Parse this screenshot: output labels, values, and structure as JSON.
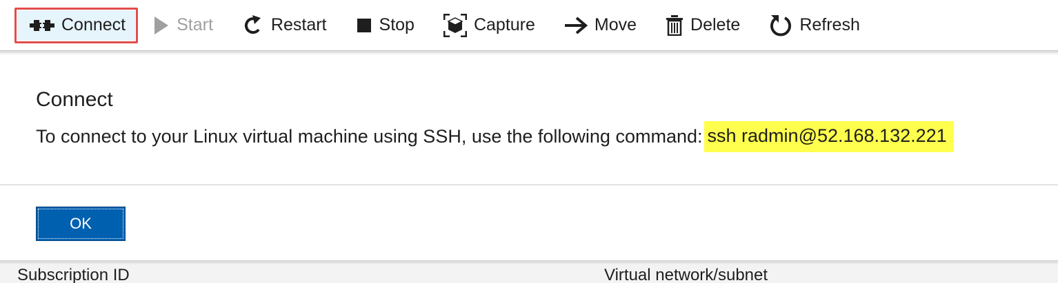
{
  "toolbar": {
    "connect": "Connect",
    "start": "Start",
    "restart": "Restart",
    "stop": "Stop",
    "capture": "Capture",
    "move": "Move",
    "delete": "Delete",
    "refresh": "Refresh"
  },
  "dialog": {
    "title": "Connect",
    "message": "To connect to your Linux virtual machine using SSH, use the following command:",
    "command": "ssh radmin@52.168.132.221",
    "ok_label": "OK"
  },
  "background": {
    "subscription_label": "Subscription ID",
    "vnet_label": "Virtual network/subnet"
  },
  "colors": {
    "highlight": "#ffff4d",
    "primary_button": "#0060b0",
    "selection_box": "#e24c4c"
  }
}
